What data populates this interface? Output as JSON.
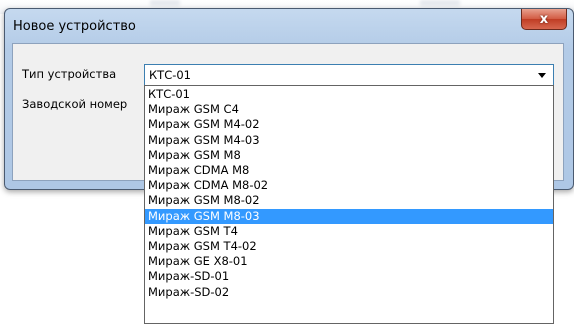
{
  "dialog": {
    "title": "Новое устройство",
    "close_label": "x",
    "type_label": "Тип устройства",
    "serial_label": "Заводской номер"
  },
  "device_combo": {
    "selected_value": "КТС-01",
    "items": [
      {
        "label": "КТС-01"
      },
      {
        "label": "Мираж GSM C4"
      },
      {
        "label": "Мираж GSM M4-02"
      },
      {
        "label": "Мираж GSM M4-03"
      },
      {
        "label": "Мираж GSM M8"
      },
      {
        "label": "Мираж CDMA M8"
      },
      {
        "label": "Мираж CDMA M8-02"
      },
      {
        "label": "Мираж GSM M8-02"
      },
      {
        "label": "Мираж GSM M8-03"
      },
      {
        "label": "Мираж GSM T4"
      },
      {
        "label": "Мираж GSM T4-02"
      },
      {
        "label": "Мираж GE X8-01"
      },
      {
        "label": "Мираж-SD-01"
      },
      {
        "label": "Мираж-SD-02"
      }
    ],
    "highlighted_item": "Мираж GSM M8-03"
  }
}
